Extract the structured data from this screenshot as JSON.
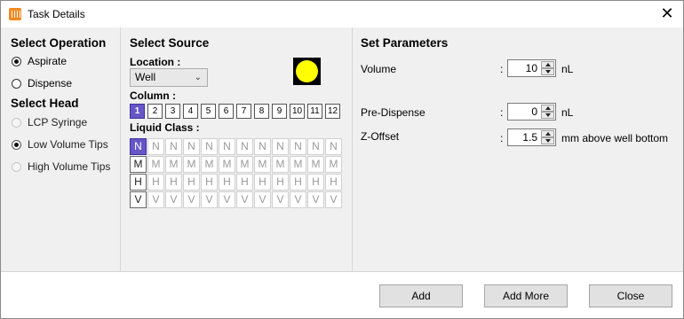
{
  "window": {
    "title": "Task Details"
  },
  "operation": {
    "title": "Select Operation",
    "options": [
      {
        "label": "Aspirate",
        "checked": true
      },
      {
        "label": "Dispense",
        "checked": false
      }
    ]
  },
  "head": {
    "title": "Select Head",
    "options": [
      {
        "label": "LCP Syringe",
        "checked": false
      },
      {
        "label": "Low Volume Tips",
        "checked": true
      },
      {
        "label": "High Volume Tips",
        "checked": false
      }
    ]
  },
  "source": {
    "title": "Select Source",
    "location_label": "Location :",
    "location_value": "Well",
    "swatch_color": "#ffff00",
    "column_label": "Column :",
    "columns": [
      "1",
      "2",
      "3",
      "4",
      "5",
      "6",
      "7",
      "8",
      "9",
      "10",
      "11",
      "12"
    ],
    "selected_column": "1",
    "liquid_class_label": "Liquid Class :",
    "liquid_classes": [
      "N",
      "M",
      "H",
      "V"
    ],
    "selected_liquid_class": "N",
    "accent_color": "#6756c6"
  },
  "params": {
    "title": "Set Parameters",
    "volume": {
      "label": "Volume",
      "colon": ":",
      "value": "10",
      "unit": "nL"
    },
    "pre_dispense": {
      "label": "Pre-Dispense",
      "colon": ":",
      "value": "0",
      "unit": "nL"
    },
    "z_offset": {
      "label": "Z-Offset",
      "colon": ":",
      "value": "1.5",
      "unit": "mm above well bottom"
    }
  },
  "buttons": {
    "add": "Add",
    "add_more": "Add More",
    "close": "Close"
  }
}
